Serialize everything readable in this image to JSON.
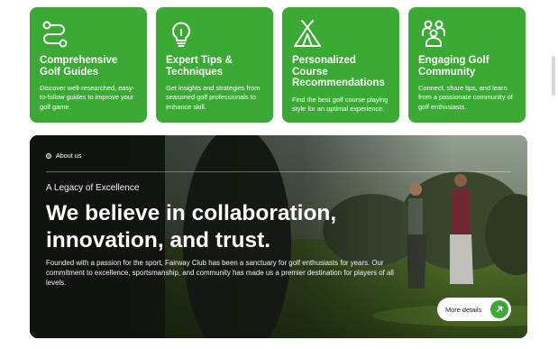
{
  "features": [
    {
      "icon": "route-icon",
      "title": "Comprehensive Golf Guides",
      "description": "Discover well-researched, easy-to-follow guides to improve your golf game."
    },
    {
      "icon": "lightbulb-icon",
      "title": "Expert Tips & Techniques",
      "description": "Get insights and strategies from seasoned golf professionals to enhance skill."
    },
    {
      "icon": "tent-icon",
      "title": "Personalized Course Recommendations",
      "description": "Find the best golf course playing style for an optimal experience."
    },
    {
      "icon": "community-icon",
      "title": "Engaging Golf Community",
      "description": "Connect, share tips, and learn from a passionate community of golf enthusiasts."
    }
  ],
  "about": {
    "tag": "About us",
    "eyebrow": "A Legacy of Excellence",
    "headline": "We believe in collaboration, innovation, and trust.",
    "body": "Founded with a passion for the sport, Fairway Club has been a sanctuary for golf enthusiasts for years. Our commitment to excellence, sportsmanship, and community has made us a premier destination for players of all levels.",
    "button_label": "More details"
  },
  "colors": {
    "accent": "#3aaa35",
    "card_text": "#ffffff",
    "button_bg": "#ffffff"
  }
}
